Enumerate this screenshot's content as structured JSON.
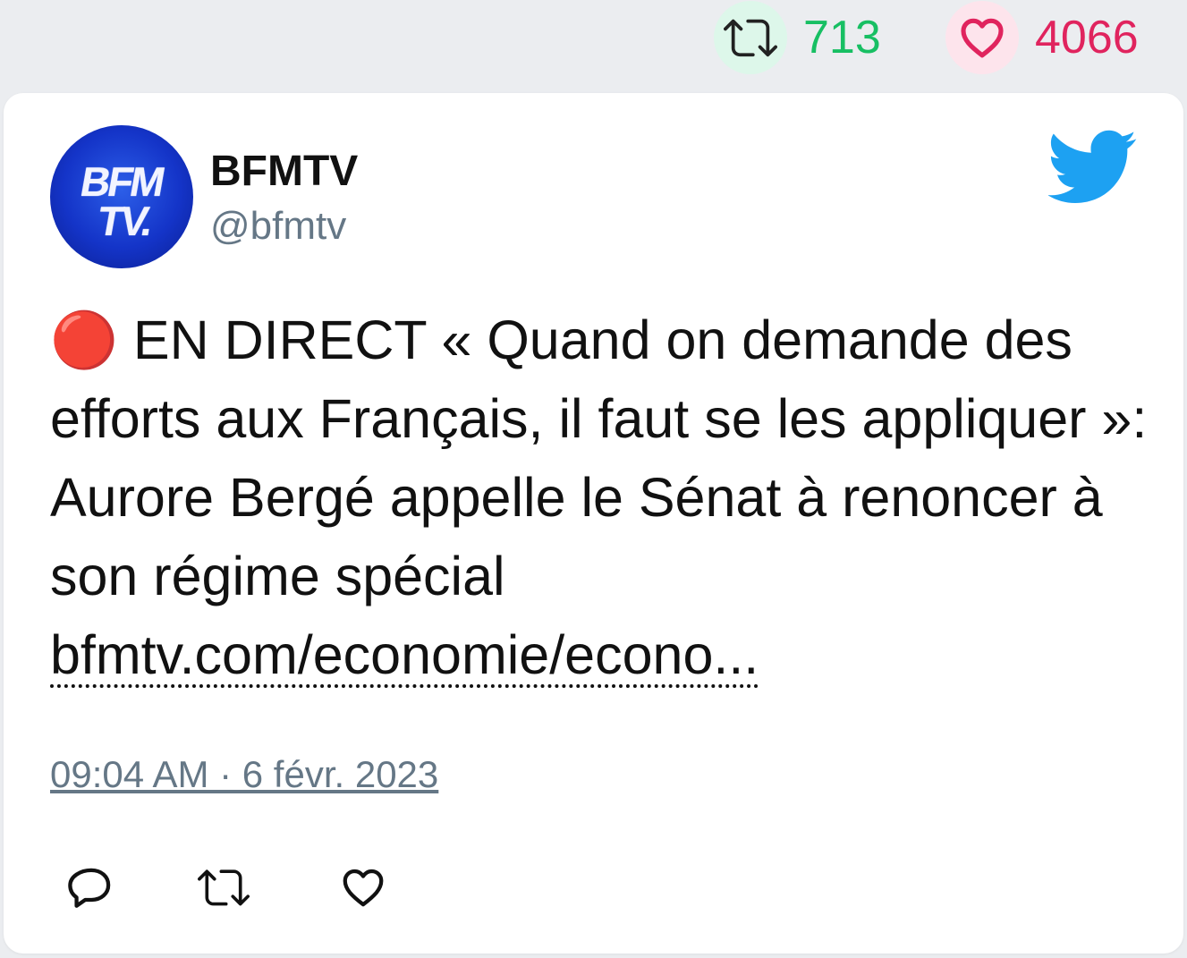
{
  "stats": {
    "retweet_icon": "retweet-icon",
    "retweet_count": "713",
    "retweet_color": "#17bf63",
    "like_icon": "heart-icon",
    "like_count": "4066",
    "like_color": "#e0245e"
  },
  "tweet": {
    "author_name": "BFMTV",
    "author_handle": "@bfmtv",
    "avatar_logo_line1": "BFM",
    "avatar_logo_line2": "TV.",
    "platform_icon": "twitter-bird-icon",
    "platform_color": "#1da1f2",
    "text": "🔴 EN DIRECT « Quand on demande des efforts aux Français, il faut se les appliquer »: Aurore Bergé appelle le Sénat à renoncer à son régime spécial",
    "link_text": "bfmtv.com/economie/econo...",
    "timestamp": "09:04 AM · 6 févr. 2023"
  },
  "actions": [
    {
      "icon": "reply-icon"
    },
    {
      "icon": "retweet-icon"
    },
    {
      "icon": "like-icon"
    }
  ]
}
